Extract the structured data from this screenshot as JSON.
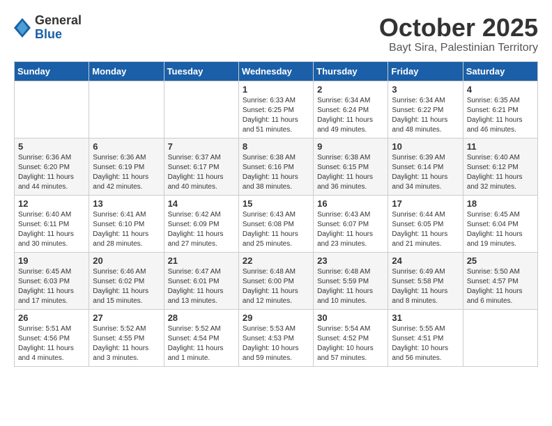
{
  "logo": {
    "general": "General",
    "blue": "Blue"
  },
  "title": "October 2025",
  "subtitle": "Bayt Sira, Palestinian Territory",
  "days_of_week": [
    "Sunday",
    "Monday",
    "Tuesday",
    "Wednesday",
    "Thursday",
    "Friday",
    "Saturday"
  ],
  "weeks": [
    [
      {
        "day": "",
        "info": ""
      },
      {
        "day": "",
        "info": ""
      },
      {
        "day": "",
        "info": ""
      },
      {
        "day": "1",
        "info": "Sunrise: 6:33 AM\nSunset: 6:25 PM\nDaylight: 11 hours\nand 51 minutes."
      },
      {
        "day": "2",
        "info": "Sunrise: 6:34 AM\nSunset: 6:24 PM\nDaylight: 11 hours\nand 49 minutes."
      },
      {
        "day": "3",
        "info": "Sunrise: 6:34 AM\nSunset: 6:22 PM\nDaylight: 11 hours\nand 48 minutes."
      },
      {
        "day": "4",
        "info": "Sunrise: 6:35 AM\nSunset: 6:21 PM\nDaylight: 11 hours\nand 46 minutes."
      }
    ],
    [
      {
        "day": "5",
        "info": "Sunrise: 6:36 AM\nSunset: 6:20 PM\nDaylight: 11 hours\nand 44 minutes."
      },
      {
        "day": "6",
        "info": "Sunrise: 6:36 AM\nSunset: 6:19 PM\nDaylight: 11 hours\nand 42 minutes."
      },
      {
        "day": "7",
        "info": "Sunrise: 6:37 AM\nSunset: 6:17 PM\nDaylight: 11 hours\nand 40 minutes."
      },
      {
        "day": "8",
        "info": "Sunrise: 6:38 AM\nSunset: 6:16 PM\nDaylight: 11 hours\nand 38 minutes."
      },
      {
        "day": "9",
        "info": "Sunrise: 6:38 AM\nSunset: 6:15 PM\nDaylight: 11 hours\nand 36 minutes."
      },
      {
        "day": "10",
        "info": "Sunrise: 6:39 AM\nSunset: 6:14 PM\nDaylight: 11 hours\nand 34 minutes."
      },
      {
        "day": "11",
        "info": "Sunrise: 6:40 AM\nSunset: 6:12 PM\nDaylight: 11 hours\nand 32 minutes."
      }
    ],
    [
      {
        "day": "12",
        "info": "Sunrise: 6:40 AM\nSunset: 6:11 PM\nDaylight: 11 hours\nand 30 minutes."
      },
      {
        "day": "13",
        "info": "Sunrise: 6:41 AM\nSunset: 6:10 PM\nDaylight: 11 hours\nand 28 minutes."
      },
      {
        "day": "14",
        "info": "Sunrise: 6:42 AM\nSunset: 6:09 PM\nDaylight: 11 hours\nand 27 minutes."
      },
      {
        "day": "15",
        "info": "Sunrise: 6:43 AM\nSunset: 6:08 PM\nDaylight: 11 hours\nand 25 minutes."
      },
      {
        "day": "16",
        "info": "Sunrise: 6:43 AM\nSunset: 6:07 PM\nDaylight: 11 hours\nand 23 minutes."
      },
      {
        "day": "17",
        "info": "Sunrise: 6:44 AM\nSunset: 6:05 PM\nDaylight: 11 hours\nand 21 minutes."
      },
      {
        "day": "18",
        "info": "Sunrise: 6:45 AM\nSunset: 6:04 PM\nDaylight: 11 hours\nand 19 minutes."
      }
    ],
    [
      {
        "day": "19",
        "info": "Sunrise: 6:45 AM\nSunset: 6:03 PM\nDaylight: 11 hours\nand 17 minutes."
      },
      {
        "day": "20",
        "info": "Sunrise: 6:46 AM\nSunset: 6:02 PM\nDaylight: 11 hours\nand 15 minutes."
      },
      {
        "day": "21",
        "info": "Sunrise: 6:47 AM\nSunset: 6:01 PM\nDaylight: 11 hours\nand 13 minutes."
      },
      {
        "day": "22",
        "info": "Sunrise: 6:48 AM\nSunset: 6:00 PM\nDaylight: 11 hours\nand 12 minutes."
      },
      {
        "day": "23",
        "info": "Sunrise: 6:48 AM\nSunset: 5:59 PM\nDaylight: 11 hours\nand 10 minutes."
      },
      {
        "day": "24",
        "info": "Sunrise: 6:49 AM\nSunset: 5:58 PM\nDaylight: 11 hours\nand 8 minutes."
      },
      {
        "day": "25",
        "info": "Sunrise: 5:50 AM\nSunset: 4:57 PM\nDaylight: 11 hours\nand 6 minutes."
      }
    ],
    [
      {
        "day": "26",
        "info": "Sunrise: 5:51 AM\nSunset: 4:56 PM\nDaylight: 11 hours\nand 4 minutes."
      },
      {
        "day": "27",
        "info": "Sunrise: 5:52 AM\nSunset: 4:55 PM\nDaylight: 11 hours\nand 3 minutes."
      },
      {
        "day": "28",
        "info": "Sunrise: 5:52 AM\nSunset: 4:54 PM\nDaylight: 11 hours\nand 1 minute."
      },
      {
        "day": "29",
        "info": "Sunrise: 5:53 AM\nSunset: 4:53 PM\nDaylight: 10 hours\nand 59 minutes."
      },
      {
        "day": "30",
        "info": "Sunrise: 5:54 AM\nSunset: 4:52 PM\nDaylight: 10 hours\nand 57 minutes."
      },
      {
        "day": "31",
        "info": "Sunrise: 5:55 AM\nSunset: 4:51 PM\nDaylight: 10 hours\nand 56 minutes."
      },
      {
        "day": "",
        "info": ""
      }
    ]
  ]
}
